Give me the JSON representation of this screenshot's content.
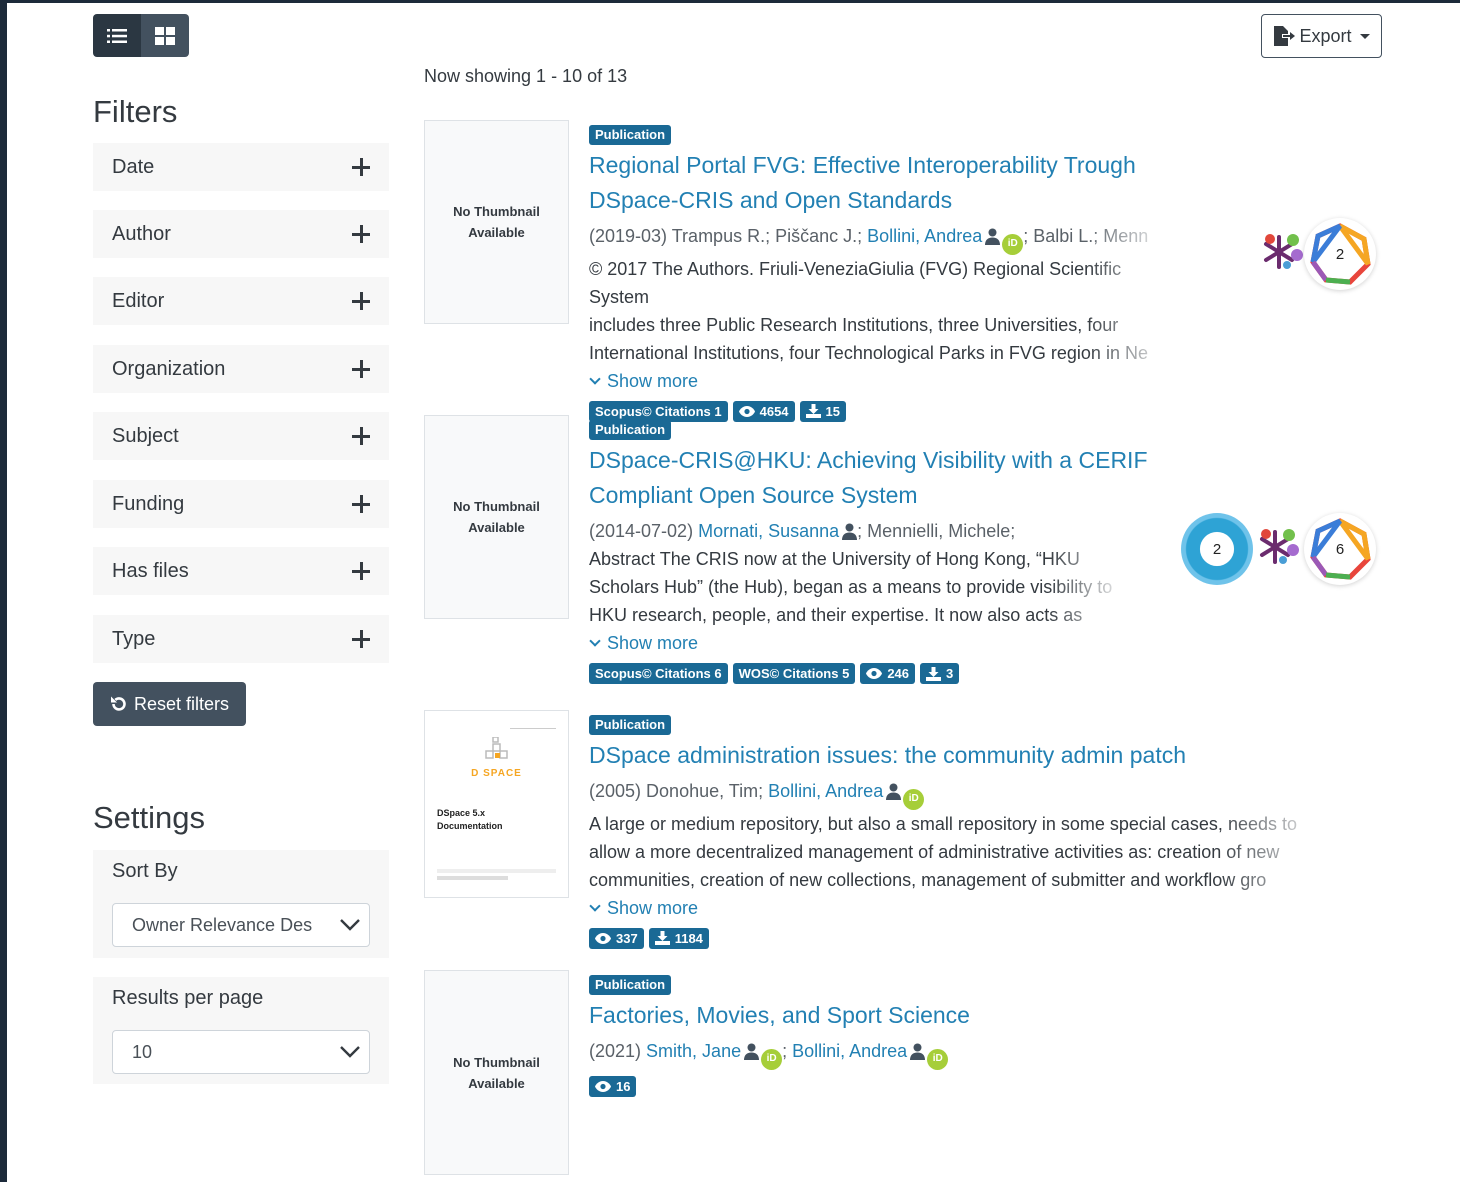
{
  "view": {
    "list_label": "list view",
    "grid_label": "grid view"
  },
  "export": {
    "label": "Export"
  },
  "filters": {
    "title": "Filters",
    "facets": [
      "Date",
      "Author",
      "Editor",
      "Organization",
      "Subject",
      "Funding",
      "Has files",
      "Type"
    ],
    "reset_label": "Reset filters"
  },
  "settings": {
    "title": "Settings",
    "sort_label": "Sort By",
    "sort_value": "Owner Relevance Des",
    "rpp_label": "Results per page",
    "rpp_value": "10"
  },
  "results": {
    "now_showing": "Now showing 1 - 10 of 13",
    "no_thumb": "No Thumbnail Available",
    "show_more": "Show more",
    "items": [
      {
        "type": "Publication",
        "title_line1": "Regional Portal FVG: Effective Interoperability Trough",
        "title_line2": "DSpace-CRIS and Open Standards",
        "date": "(2019-03)",
        "authors_pre": "Trampus R.; Piščanc J.;",
        "author_link": "Bollini, Andrea",
        "authors_post": "; Balbi L.; Menn",
        "abstract_lines": [
          "© 2017 The Authors. Friuli-VeneziaGiulia (FVG) Regional Scientific System",
          "includes three Public Research Institutions, three Universities, four",
          "International Institutions, four Technological Parks in FVG region in Ne"
        ],
        "stats": {
          "scopus": "Scopus© Citations 1",
          "views": "4654",
          "downloads": "15"
        },
        "dimensions": "2"
      },
      {
        "type": "Publication",
        "title_line1": "DSpace-CRIS@HKU: Achieving Visibility with a CERIF",
        "title_line2": "Compliant Open Source System",
        "date": "(2014-07-02)",
        "author_link": "Mornati, Susanna",
        "authors_post": "; Mennielli, Michele;",
        "abstract_lines": [
          "Abstract The CRIS now at the University of Hong Kong, “HKU",
          "Scholars Hub” (the Hub), began as a means to provide visibility to",
          "HKU research, people, and their expertise. It now also acts as"
        ],
        "stats": {
          "scopus": "Scopus© Citations 6",
          "wos": "WOS© Citations 5",
          "views": "246",
          "downloads": "3"
        },
        "altmetric": "2",
        "dimensions": "6"
      },
      {
        "type": "Publication",
        "title_line1": "DSpace administration issues: the community admin patch",
        "date": "(2005)",
        "authors_pre": "Donohue, Tim;",
        "author_link": "Bollini, Andrea",
        "abstract_lines": [
          "A large or medium repository, but also a small repository in some special cases, needs to",
          "allow a more decentralized management of administrative activities as: creation of new",
          "communities, creation of new collections, management of submitter and workflow gro"
        ],
        "stats": {
          "views": "337",
          "downloads": "1184"
        },
        "thumb_brand": "D SPACE",
        "thumb_title": "DSpace 5.x Documentation"
      },
      {
        "type": "Publication",
        "title_line1": "Factories, Movies, and Sport Science",
        "date": "(2021)",
        "author_link": "Smith, Jane",
        "author_link2": "Bollini, Andrea",
        "stats": {
          "views": "16"
        }
      }
    ]
  },
  "orcid_label": "iD",
  "colors": {
    "primary": "#1a6995",
    "link": "#2280b3",
    "dark": "#43515f",
    "orcid": "#a6ce39"
  }
}
